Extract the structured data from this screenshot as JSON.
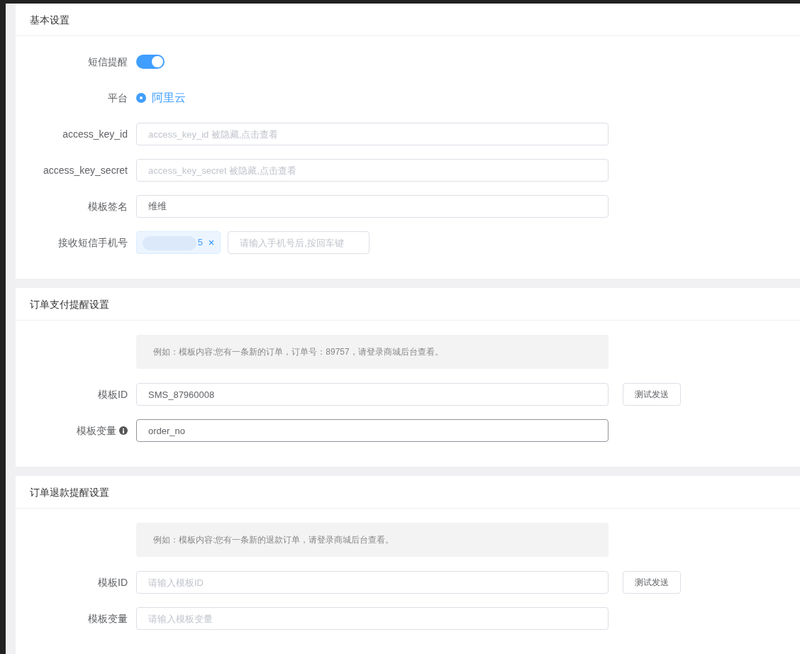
{
  "sections": [
    {
      "title": "基本设置",
      "fields": [
        {
          "kind": "switch",
          "label": "短信提醒",
          "on": true
        },
        {
          "kind": "radio",
          "label": "平台",
          "options": [
            {
              "label": "阿里云",
              "selected": true
            }
          ]
        },
        {
          "kind": "input",
          "label": "access_key_id",
          "placeholder": "access_key_id 被隐藏,点击查看"
        },
        {
          "kind": "input",
          "label": "access_key_secret",
          "placeholder": "access_key_secret 被隐藏,点击查看"
        },
        {
          "kind": "input",
          "label": "模板签名",
          "value": "维维"
        },
        {
          "kind": "tags",
          "label": "接收短信手机号",
          "tags": [
            "5"
          ],
          "placeholder": "请输入手机号后,按回车键"
        }
      ]
    },
    {
      "title": "订单支付提醒设置",
      "note": "例如：模板内容:您有一条新的订单，订单号：89757，请登录商城后台查看。",
      "fields": [
        {
          "kind": "input",
          "label": "模板ID",
          "value": "SMS_87960008",
          "button": "测试发送"
        },
        {
          "kind": "input",
          "label": "模板变量",
          "info": true,
          "value": "order_no",
          "focused": true
        }
      ]
    },
    {
      "title": "订单退款提醒设置",
      "note": "例如：模板内容:您有一条新的退款订单，请登录商城后台查看。",
      "fields": [
        {
          "kind": "input",
          "label": "模板ID",
          "placeholder": "请输入模板ID",
          "button": "测试发送"
        },
        {
          "kind": "input",
          "label": "模板变量",
          "placeholder": "请输入模板变量"
        }
      ]
    }
  ]
}
